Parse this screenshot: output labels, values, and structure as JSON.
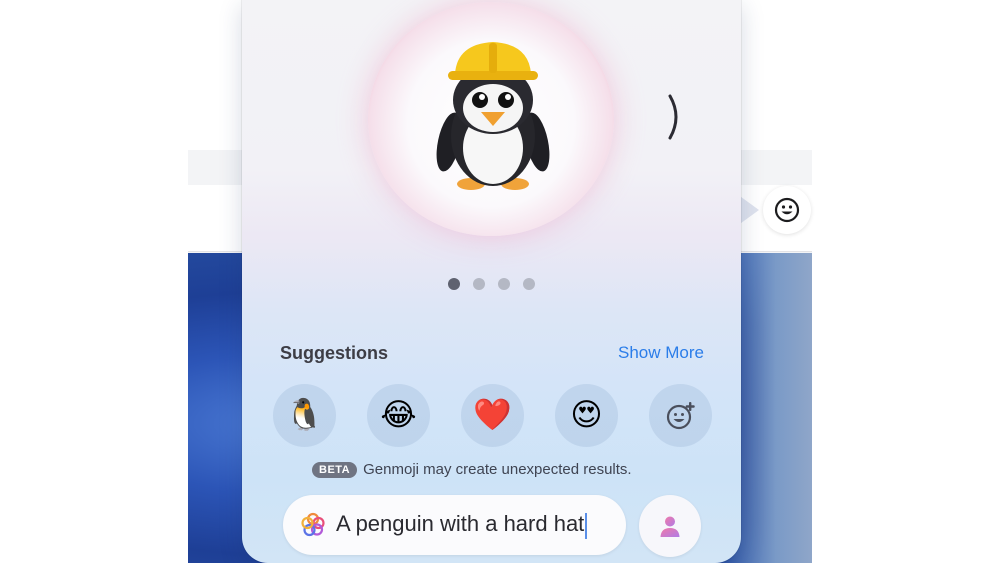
{
  "preview": {
    "carousel": {
      "page_count": 4,
      "active_index": 0
    },
    "next_icon": "chevron-right-icon"
  },
  "suggestions": {
    "title": "Suggestions",
    "show_more_label": "Show More",
    "items": [
      {
        "emoji": "🐧",
        "name": "penguin"
      },
      {
        "emoji": "😂",
        "name": "tears-of-joy"
      },
      {
        "emoji": "❤️",
        "name": "red-heart"
      },
      {
        "emoji": "😍",
        "name": "heart-eyes"
      },
      {
        "emoji": "",
        "name": "add-emoji"
      }
    ]
  },
  "notice": {
    "badge": "BETA",
    "text": "Genmoji may create unexpected results."
  },
  "prompt": {
    "value": "A penguin with a hard hat",
    "icon": "genmoji-sparkle-icon",
    "person_button_icon": "person-icon"
  },
  "toolbar": {
    "emoji_button_icon": "smiley-icon"
  },
  "colors": {
    "accent": "#2b7de9",
    "beta_badge": "#6f7482",
    "dot_active": "#5f6270",
    "dot_inactive": "#b4b8c4"
  }
}
